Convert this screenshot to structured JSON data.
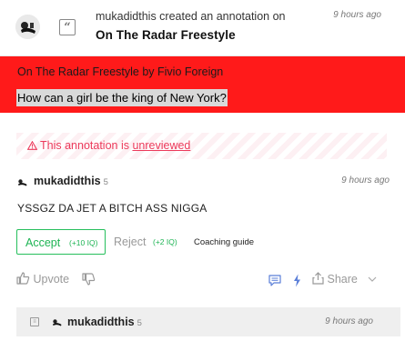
{
  "header": {
    "action_text": "mukadidthis created an annotation on",
    "song_title": "On The Radar Freestyle",
    "time": "9 hours ago",
    "type_icon": "quote-icon"
  },
  "lyric": {
    "song_line": "On The Radar Freestyle by Fivio Foreign",
    "highlighted_line": "How can a girl be the king of New York?",
    "background_color": "#ff1a1a"
  },
  "status": {
    "prefix": "This annotation is ",
    "link": "unreviewed",
    "color": "#ec3a5b",
    "icon": "warning-icon"
  },
  "annotation": {
    "author": "mukadidthis",
    "iq": "5",
    "time": "9 hours ago",
    "body": "YSSGZ DA JET A BITCH ASS NIGGA"
  },
  "review": {
    "accept_label": "Accept",
    "accept_iq": "(+10 IQ)",
    "reject_label": "Reject",
    "reject_iq": "(+2 IQ)",
    "coaching_label": "Coaching guide",
    "accept_color": "#26bf5c"
  },
  "actions": {
    "upvote_label": "Upvote",
    "share_label": "Share"
  },
  "reply": {
    "author": "mukadidthis",
    "iq": "5",
    "time": "9 hours ago"
  }
}
